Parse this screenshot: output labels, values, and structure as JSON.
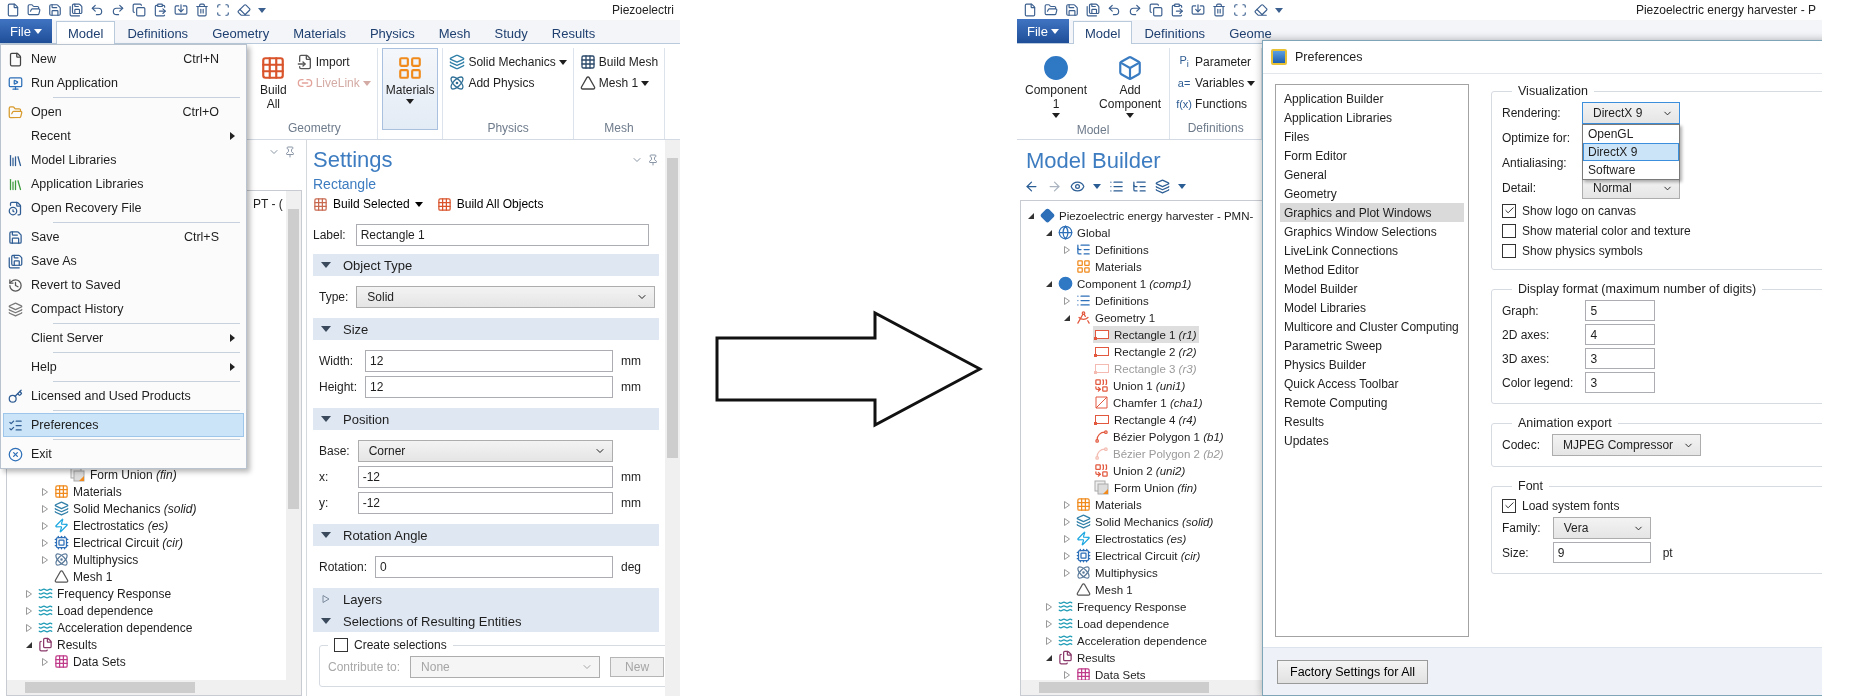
{
  "left_window": {
    "title": "Piezoelectri",
    "file_button": "File",
    "ribbon_tabs": [
      {
        "label": "Model",
        "selected": true
      },
      {
        "label": "Definitions",
        "selected": false
      },
      {
        "label": "Geometry",
        "selected": false
      },
      {
        "label": "Materials",
        "selected": false
      },
      {
        "label": "Physics",
        "selected": false
      },
      {
        "label": "Mesh",
        "selected": false
      },
      {
        "label": "Study",
        "selected": false
      },
      {
        "label": "Results",
        "selected": false
      }
    ],
    "ribbon_groups": [
      {
        "label": "Geometry",
        "buttons": [
          {
            "kind": "build-all",
            "label": "Build All",
            "dropdown": false,
            "highlighted": false
          },
          {
            "kind": "import",
            "label": "Import",
            "dropdown": false,
            "highlighted": false
          },
          {
            "kind": "livelink",
            "label": "LiveLink",
            "dropdown": true,
            "disabled": true,
            "highlighted": false
          }
        ]
      },
      {
        "buttons": [
          {
            "kind": "materials",
            "label": "Materials",
            "dropdown": true,
            "highlighted": true
          }
        ]
      },
      {
        "label": "Physics",
        "buttons": [
          {
            "kind": "solid",
            "label": "Solid Mechanics",
            "dropdown": true,
            "highlighted": false
          },
          {
            "kind": "add-physics",
            "label": "Add Physics",
            "dropdown": false,
            "highlighted": false
          }
        ]
      },
      {
        "label": "Mesh",
        "buttons": [
          {
            "kind": "build-mesh",
            "label": "Build Mesh",
            "dropdown": false,
            "highlighted": false
          },
          {
            "kind": "mesh",
            "label": "Mesh 1",
            "dropdown": true,
            "highlighted": false
          }
        ]
      }
    ],
    "file_menu": [
      {
        "kind": "new",
        "label": "New",
        "shortcut": "Ctrl+N",
        "submenu": false,
        "selected": false
      },
      {
        "kind": "run",
        "label": "Run Application",
        "submenu": false,
        "selected": false
      },
      {
        "kind": "separator"
      },
      {
        "kind": "open",
        "label": "Open",
        "shortcut": "Ctrl+O",
        "submenu": false,
        "selected": false
      },
      {
        "kind": "plain",
        "label": "Recent",
        "submenu": true,
        "selected": false
      },
      {
        "kind": "model-libraries",
        "label": "Model Libraries",
        "submenu": false,
        "selected": false
      },
      {
        "kind": "app-libraries",
        "label": "Application Libraries",
        "submenu": false,
        "selected": false
      },
      {
        "kind": "recovery",
        "label": "Open Recovery File",
        "submenu": false,
        "selected": false
      },
      {
        "kind": "separator"
      },
      {
        "kind": "save",
        "label": "Save",
        "shortcut": "Ctrl+S",
        "submenu": false,
        "selected": false
      },
      {
        "kind": "save-as",
        "label": "Save As",
        "submenu": false,
        "selected": false
      },
      {
        "kind": "revert",
        "label": "Revert to Saved",
        "submenu": false,
        "selected": false
      },
      {
        "kind": "compact",
        "label": "Compact History",
        "submenu": false,
        "selected": false
      },
      {
        "kind": "separator"
      },
      {
        "kind": "plain",
        "label": "Client Server",
        "submenu": true,
        "selected": false
      },
      {
        "kind": "separator"
      },
      {
        "kind": "plain",
        "label": "Help",
        "submenu": true,
        "selected": false
      },
      {
        "kind": "separator"
      },
      {
        "kind": "licensed",
        "label": "Licensed and Used Products",
        "submenu": false,
        "selected": false
      },
      {
        "kind": "separator"
      },
      {
        "kind": "preferences",
        "label": "Preferences",
        "submenu": false,
        "selected": true
      },
      {
        "kind": "separator"
      },
      {
        "kind": "exit",
        "label": "Exit",
        "submenu": false,
        "selected": false
      }
    ],
    "model_tree": {
      "cut_row": "PT - (",
      "items": [
        {
          "children": [
            {
              "children": [
                {
                  "kind": "form-union",
                  "label": "Form Union",
                  "tag": "(fin)",
                  "selected": false
                }
              ]
            },
            {
              "kind": "materials",
              "label": "Materials",
              "expanded": false,
              "selected": false
            },
            {
              "kind": "solid",
              "label": "Solid Mechanics",
              "tag": "(solid)",
              "expanded": false,
              "selected": false
            },
            {
              "kind": "electrostatics",
              "label": "Electrostatics",
              "tag": "(es)",
              "expanded": false,
              "selected": false
            },
            {
              "kind": "circuit",
              "label": "Electrical Circuit",
              "tag": "(cir)",
              "expanded": false,
              "selected": false
            },
            {
              "kind": "multiphysics",
              "label": "Multiphysics",
              "expanded": false,
              "selected": false
            },
            {
              "kind": "mesh",
              "label": "Mesh 1",
              "selected": false
            }
          ]
        },
        {
          "kind": "study",
          "label": "Frequency Response",
          "expanded": false,
          "selected": false
        },
        {
          "kind": "study",
          "label": "Load dependence",
          "expanded": false,
          "selected": false
        },
        {
          "kind": "study",
          "label": "Acceleration dependence",
          "expanded": false,
          "selected": false
        },
        {
          "kind": "results",
          "label": "Results",
          "expanded": true,
          "selected": false,
          "children": [
            {
              "kind": "datasets",
              "label": "Data Sets",
              "expanded": false,
              "selected": false
            }
          ]
        }
      ]
    },
    "settings": {
      "title": "Settings",
      "subtitle": "Rectangle",
      "actions": [
        {
          "kind": "build-selected",
          "label": "Build Selected",
          "dropdown": true
        },
        {
          "kind": "build-all",
          "label": "Build All Objects",
          "dropdown": false
        }
      ],
      "label_field": {
        "label": "Label:",
        "value": "Rectangle 1"
      },
      "sections": [
        {
          "title": "Object Type",
          "expanded": true,
          "rows": [
            {
              "kind": "select",
              "label": "Type:",
              "value": "Solid"
            }
          ]
        },
        {
          "title": "Size",
          "expanded": true,
          "rows": [
            {
              "kind": "text",
              "label": "Width:",
              "value": "12",
              "unit": "mm"
            },
            {
              "kind": "text",
              "label": "Height:",
              "value": "12",
              "unit": "mm"
            }
          ]
        },
        {
          "title": "Position",
          "expanded": true,
          "rows": [
            {
              "kind": "select",
              "label": "Base:",
              "value": "Corner"
            },
            {
              "kind": "text",
              "label": "x:",
              "value": "-12",
              "unit": "mm"
            },
            {
              "kind": "text",
              "label": "y:",
              "value": "-12",
              "unit": "mm"
            }
          ]
        },
        {
          "title": "Rotation Angle",
          "expanded": true,
          "rows": [
            {
              "kind": "text",
              "label": "Rotation:",
              "value": "0",
              "unit": "deg"
            }
          ]
        },
        {
          "title": "Layers",
          "expanded": false
        },
        {
          "title": "Selections of Resulting Entities",
          "expanded": true,
          "group": {
            "label": "Create selections",
            "checked": false,
            "rows": [
              {
                "kind": "select",
                "label": "Contribute to:",
                "value": "None",
                "disabled": true,
                "button": "New"
              }
            ]
          }
        }
      ]
    }
  },
  "right_window": {
    "title": "Piezoelectric energy harvester - P",
    "file_button": "File",
    "ribbon_tabs": [
      {
        "label": "Model",
        "selected": true
      },
      {
        "label": "Definitions",
        "selected": false
      },
      {
        "label": "Geome",
        "selected": false
      }
    ],
    "ribbon_groups": [
      {
        "label": "Model",
        "buttons": [
          {
            "kind": "component",
            "label": "Component 1",
            "dropdown": true
          },
          {
            "kind": "add-component",
            "label": "Add Component",
            "dropdown": true
          }
        ]
      },
      {
        "label": "Definitions",
        "buttons": [
          {
            "kind": "symbol",
            "symbol": "P$_{i}$",
            "label": "Parameter",
            "dropdown": false
          },
          {
            "kind": "symbol",
            "symbol": "a=",
            "label": "Variables",
            "dropdown": true
          },
          {
            "kind": "symbol",
            "symbol": "f(x)",
            "label": "Functions",
            "dropdown": false
          }
        ]
      }
    ],
    "model_builder": {
      "title": "Model Builder",
      "tree": [
        {
          "kind": "root",
          "label": "Piezoelectric energy harvester - PMN-",
          "expanded": true,
          "selected": false,
          "children": [
            {
              "kind": "global",
              "label": "Global",
              "expanded": true,
              "selected": false,
              "children": [
                {
                  "kind": "definitions-global",
                  "label": "Definitions",
                  "expanded": false,
                  "selected": false
                },
                {
                  "kind": "materials-global",
                  "label": "Materials",
                  "selected": false
                }
              ]
            },
            {
              "kind": "component",
              "label": "Component 1",
              "tag": "(comp1)",
              "expanded": true,
              "selected": false,
              "children": [
                {
                  "kind": "definitions",
                  "label": "Definitions",
                  "expanded": false,
                  "selected": false
                },
                {
                  "kind": "geometry",
                  "label": "Geometry 1",
                  "expanded": true,
                  "selected": false,
                  "children": [
                    {
                      "kind": "rectangle",
                      "label": "Rectangle 1",
                      "tag": "(r1)",
                      "selected": true,
                      "disabled": false
                    },
                    {
                      "kind": "rectangle",
                      "label": "Rectangle 2",
                      "tag": "(r2)",
                      "selected": false,
                      "disabled": false
                    },
                    {
                      "kind": "rectangle",
                      "label": "Rectangle 3",
                      "tag": "(r3)",
                      "selected": false,
                      "disabled": true
                    },
                    {
                      "kind": "union",
                      "label": "Union 1",
                      "tag": "(uni1)",
                      "selected": false,
                      "disabled": false
                    },
                    {
                      "kind": "chamfer",
                      "label": "Chamfer 1",
                      "tag": "(cha1)",
                      "selected": false,
                      "disabled": false
                    },
                    {
                      "kind": "rectangle",
                      "label": "Rectangle 4",
                      "tag": "(r4)",
                      "selected": false,
                      "disabled": false
                    },
                    {
                      "kind": "bezier",
                      "label": "Bézier Polygon 1",
                      "tag": "(b1)",
                      "selected": false,
                      "disabled": false
                    },
                    {
                      "kind": "bezier",
                      "label": "Bézier Polygon 2",
                      "tag": "(b2)",
                      "selected": false,
                      "disabled": true
                    },
                    {
                      "kind": "union",
                      "label": "Union 2",
                      "tag": "(uni2)",
                      "selected": false,
                      "disabled": false
                    },
                    {
                      "kind": "form-union",
                      "label": "Form Union",
                      "tag": "(fin)",
                      "selected": false,
                      "disabled": false
                    }
                  ]
                },
                {
                  "kind": "materials",
                  "label": "Materials",
                  "expanded": false,
                  "selected": false
                },
                {
                  "kind": "solid",
                  "label": "Solid Mechanics",
                  "tag": "(solid)",
                  "expanded": false,
                  "selected": false
                },
                {
                  "kind": "electrostatics",
                  "label": "Electrostatics",
                  "tag": "(es)",
                  "expanded": false,
                  "selected": false
                },
                {
                  "kind": "circuit",
                  "label": "Electrical Circuit",
                  "tag": "(cir)",
                  "expanded": false,
                  "selected": false
                },
                {
                  "kind": "multiphysics",
                  "label": "Multiphysics",
                  "expanded": false,
                  "selected": false
                },
                {
                  "kind": "mesh",
                  "label": "Mesh 1",
                  "selected": false
                }
              ]
            },
            {
              "kind": "study",
              "label": "Frequency Response",
              "expanded": false,
              "selected": false
            },
            {
              "kind": "study",
              "label": "Load dependence",
              "expanded": false,
              "selected": false
            },
            {
              "kind": "study",
              "label": "Acceleration dependence",
              "expanded": false,
              "selected": false
            },
            {
              "kind": "results",
              "label": "Results",
              "expanded": true,
              "selected": false,
              "children": [
                {
                  "kind": "datasets",
                  "label": "Data Sets",
                  "expanded": false,
                  "selected": false
                }
              ]
            }
          ]
        }
      ]
    },
    "preferences": {
      "title": "Preferences",
      "categories": [
        {
          "label": "Application Builder",
          "selected": false
        },
        {
          "label": "Application Libraries",
          "selected": false
        },
        {
          "label": "Files",
          "selected": false
        },
        {
          "label": "Form Editor",
          "selected": false
        },
        {
          "label": "General",
          "selected": false
        },
        {
          "label": "Geometry",
          "selected": false
        },
        {
          "label": "Graphics and Plot Windows",
          "selected": true
        },
        {
          "label": "Graphics Window Selections",
          "selected": false
        },
        {
          "label": "LiveLink Connections",
          "selected": false
        },
        {
          "label": "Method Editor",
          "selected": false
        },
        {
          "label": "Model Builder",
          "selected": false
        },
        {
          "label": "Model Libraries",
          "selected": false
        },
        {
          "label": "Multicore and Cluster Computing",
          "selected": false
        },
        {
          "label": "Parametric Sweep",
          "selected": false
        },
        {
          "label": "Physics Builder",
          "selected": false
        },
        {
          "label": "Quick Access Toolbar",
          "selected": false
        },
        {
          "label": "Remote Computing",
          "selected": false
        },
        {
          "label": "Results",
          "selected": false
        },
        {
          "label": "Updates",
          "selected": false
        }
      ],
      "sections": [
        {
          "title": "Visualization",
          "rows": [
            {
              "kind": "select",
              "label": "Rendering:",
              "value": "DirectX 9",
              "open": true,
              "options": [
                {
                  "label": "OpenGL",
                  "selected": false
                },
                {
                  "label": "DirectX 9",
                  "selected": true
                },
                {
                  "label": "Software",
                  "selected": false
                }
              ]
            },
            {
              "kind": "label",
              "label": "Optimize for:"
            },
            {
              "kind": "label",
              "label": "Antialiasing:"
            },
            {
              "kind": "select",
              "label": "Detail:",
              "value": "Normal",
              "open": false
            },
            {
              "kind": "checkbox",
              "label": "Show logo on canvas",
              "checked": true
            },
            {
              "kind": "checkbox",
              "label": "Show material color and texture",
              "checked": false
            },
            {
              "kind": "checkbox",
              "label": "Show physics symbols",
              "checked": false
            }
          ]
        },
        {
          "title": "Display format (maximum number of digits)",
          "rows": [
            {
              "kind": "text",
              "label": "Graph:",
              "value": "5"
            },
            {
              "kind": "text",
              "label": "2D axes:",
              "value": "4"
            },
            {
              "kind": "text",
              "label": "3D axes:",
              "value": "3"
            },
            {
              "kind": "text",
              "label": "Color legend:",
              "value": "3"
            }
          ]
        },
        {
          "title": "Animation export",
          "rows": [
            {
              "kind": "select",
              "label": "Codec:",
              "value": "MJPEG Compressor",
              "open": false
            }
          ]
        },
        {
          "title": "Font",
          "rows": [
            {
              "kind": "checkbox",
              "label": "Load system fonts",
              "checked": true
            },
            {
              "kind": "select",
              "label": "Family:",
              "value": "Vera",
              "open": false
            },
            {
              "kind": "text",
              "label": "Size:",
              "value": "9",
              "unit": "pt"
            }
          ]
        }
      ],
      "factory_button": "Factory Settings for All"
    }
  }
}
